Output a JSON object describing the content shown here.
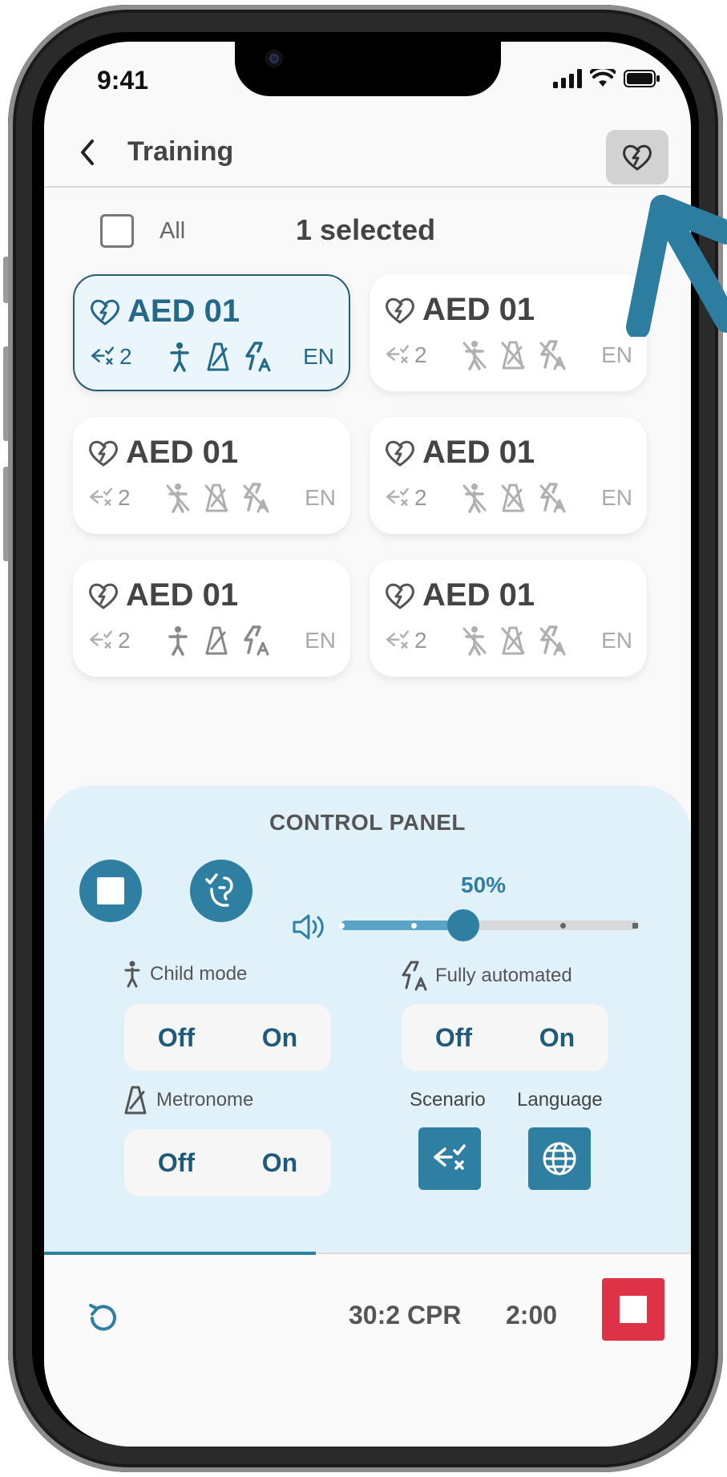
{
  "status_bar": {
    "time": "9:41"
  },
  "header": {
    "title": "Training",
    "back_icon": "chevron-left-icon",
    "aed_icon": "heart-bolt-icon"
  },
  "selection": {
    "all_label": "All",
    "selected_text": "1 selected",
    "all_checked": false
  },
  "devices": [
    {
      "name": "AED 01",
      "scenario": "2",
      "language": "EN",
      "selected": true,
      "child_mode": true,
      "metronome": true,
      "fully_automated": true
    },
    {
      "name": "AED 01",
      "scenario": "2",
      "language": "EN",
      "selected": false,
      "child_mode": false,
      "metronome": false,
      "fully_automated": false
    },
    {
      "name": "AED 01",
      "scenario": "2",
      "language": "EN",
      "selected": false,
      "child_mode": false,
      "metronome": false,
      "fully_automated": false
    },
    {
      "name": "AED 01",
      "scenario": "2",
      "language": "EN",
      "selected": false,
      "child_mode": false,
      "metronome": false,
      "fully_automated": false
    },
    {
      "name": "AED 01",
      "scenario": "2",
      "language": "EN",
      "selected": false,
      "child_mode": true,
      "metronome": true,
      "fully_automated": true
    },
    {
      "name": "AED 01",
      "scenario": "2",
      "language": "EN",
      "selected": false,
      "child_mode": false,
      "metronome": false,
      "fully_automated": false
    }
  ],
  "control_panel": {
    "title": "CONTROL PANEL",
    "volume_percent": "50%",
    "volume_value": 0.5,
    "child_mode": {
      "label": "Child mode",
      "off": "Off",
      "on": "On"
    },
    "fully_automated": {
      "label": "Fully automated",
      "off": "Off",
      "on": "On"
    },
    "metronome": {
      "label": "Metronome",
      "off": "Off",
      "on": "On"
    },
    "scenario_label": "Scenario",
    "language_label": "Language"
  },
  "bottom_bar": {
    "cpr_label": "30:2 CPR",
    "timer": "2:00",
    "progress": 0.42
  },
  "colors": {
    "accent": "#2f7fa3",
    "stop_red": "#de3246",
    "selected_bg": "#eaf6fb",
    "panel_bg": "#e1f1fa"
  }
}
